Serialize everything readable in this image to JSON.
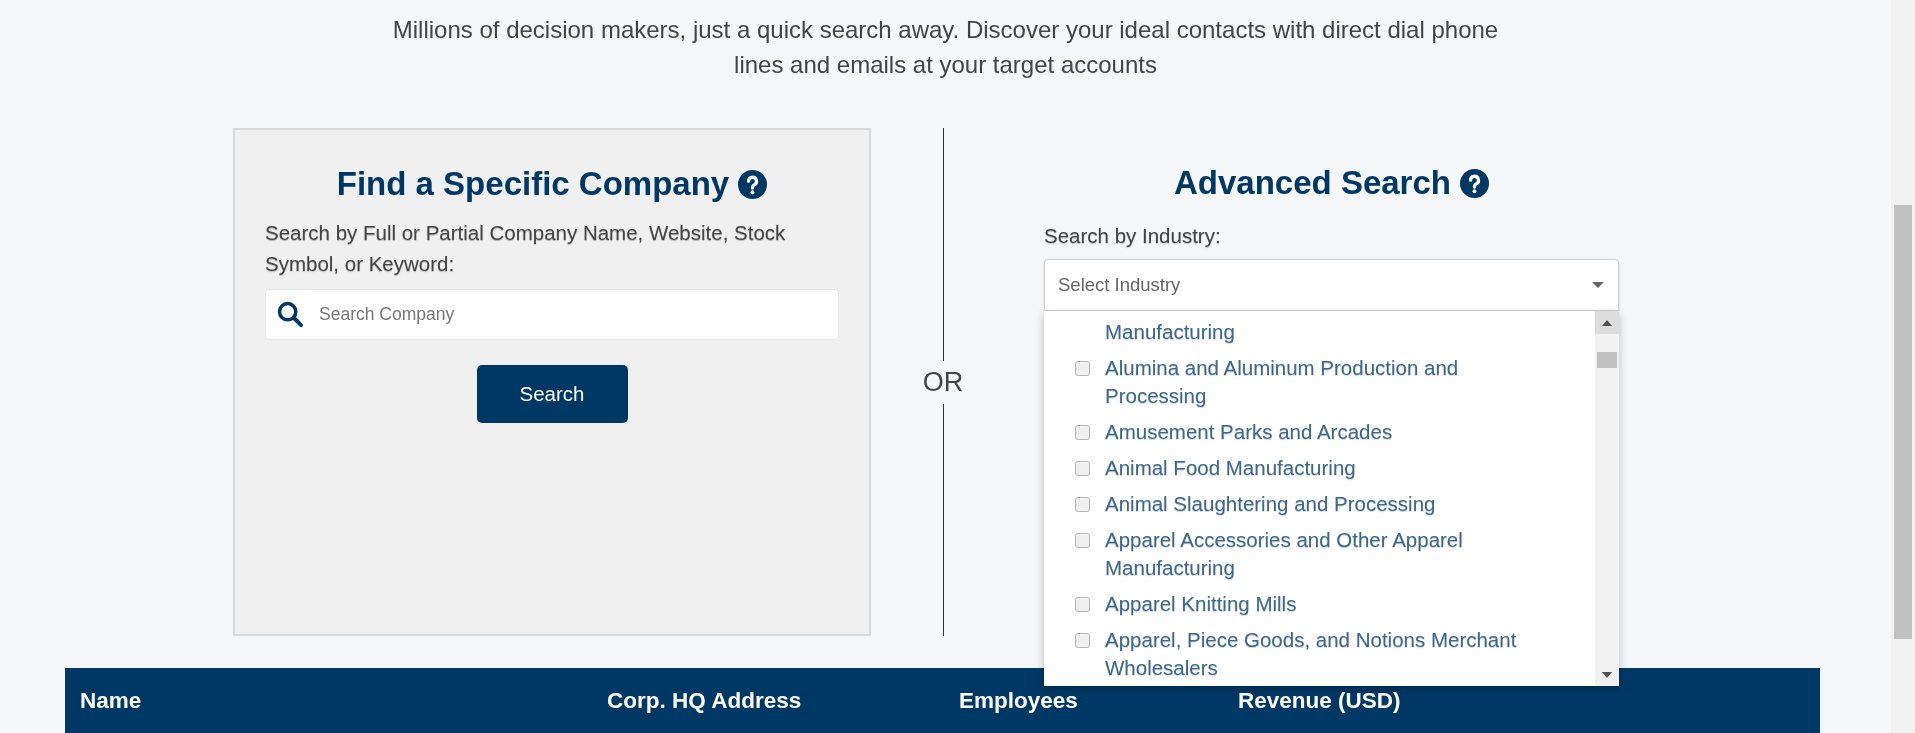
{
  "intro": {
    "text": "Millions of decision makers, just a quick search away. Discover your ideal contacts with direct dial phone lines and emails at your target accounts"
  },
  "company_search": {
    "title": "Find a Specific Company",
    "description": "Search by Full or Partial Company Name, Website, Stock Symbol, or Keyword:",
    "search_field": {
      "placeholder": "Search Company"
    },
    "button": "Search"
  },
  "divider_label": "OR",
  "advanced_search": {
    "title": "Advanced Search",
    "industry_label": "Search by Industry:",
    "industry_select": {
      "placeholder": "Select Industry",
      "expanded": true,
      "options": [
        {
          "kind": "continuation",
          "label": "Manufacturing"
        },
        {
          "kind": "checkbox",
          "label": "Alumina and Aluminum Production and Processing",
          "checked": false
        },
        {
          "kind": "checkbox",
          "label": "Amusement Parks and Arcades",
          "checked": false
        },
        {
          "kind": "checkbox",
          "label": "Animal Food Manufacturing",
          "checked": false
        },
        {
          "kind": "checkbox",
          "label": "Animal Slaughtering and Processing",
          "checked": false
        },
        {
          "kind": "checkbox",
          "label": "Apparel Accessories and Other Apparel Manufacturing",
          "checked": false
        },
        {
          "kind": "checkbox",
          "label": "Apparel Knitting Mills",
          "checked": false
        },
        {
          "kind": "checkbox",
          "label": "Apparel, Piece Goods, and Notions Merchant Wholesalers",
          "checked": false
        }
      ]
    }
  },
  "table": {
    "columns": [
      "Name",
      "Corp. HQ Address",
      "Employees",
      "Revenue (USD)"
    ]
  }
}
